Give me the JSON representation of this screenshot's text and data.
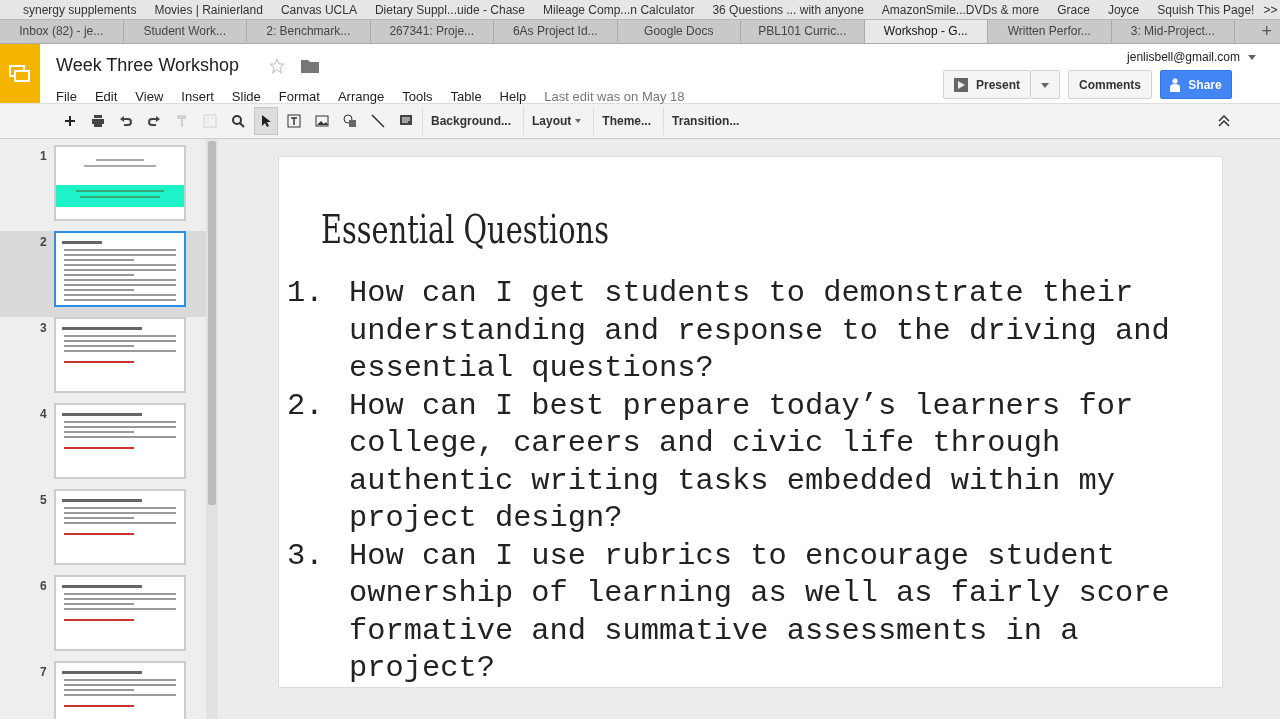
{
  "bookmarks": [
    "synergy supplements",
    "Movies | Rainierland",
    "Canvas UCLA",
    "Dietary Suppl...uide - Chase",
    "Mileage Comp...n Calculator",
    "36 Questions ... with anyone",
    "AmazonSmile...DVDs & more",
    "Grace",
    "Joyce",
    "Squish This Page!"
  ],
  "bookmarks_overflow": ">>",
  "tabs": [
    {
      "label": "Inbox (82) - je...",
      "selected": false
    },
    {
      "label": "Student Work...",
      "selected": false
    },
    {
      "label": "2: Benchmark...",
      "selected": false
    },
    {
      "label": "267341: Proje...",
      "selected": false
    },
    {
      "label": "6As Project Id...",
      "selected": false
    },
    {
      "label": "Google Docs",
      "selected": false
    },
    {
      "label": "PBL101 Curric...",
      "selected": false
    },
    {
      "label": "Workshop - G...",
      "selected": true
    },
    {
      "label": "Written Perfor...",
      "selected": false
    },
    {
      "label": "3: Mid-Project...",
      "selected": false
    }
  ],
  "new_tab": "+",
  "document": {
    "title": "Week Three Workshop",
    "starred": false
  },
  "menu": [
    "File",
    "Edit",
    "View",
    "Insert",
    "Slide",
    "Format",
    "Arrange",
    "Tools",
    "Table",
    "Help"
  ],
  "last_edit": "Last edit was on May 18",
  "account": "jenlisbell@gmail.com",
  "buttons": {
    "present": "Present",
    "comments": "Comments",
    "share": "Share"
  },
  "toolbar": [
    {
      "kind": "icon",
      "selected": false,
      "disabled": false
    },
    {
      "kind": "icon",
      "selected": false,
      "disabled": false
    },
    {
      "kind": "icon",
      "selected": false,
      "disabled": false
    },
    {
      "kind": "icon",
      "selected": false,
      "disabled": false
    },
    {
      "kind": "icon",
      "selected": false,
      "disabled": true
    },
    {
      "kind": "icon",
      "selected": false,
      "disabled": true
    },
    {
      "kind": "icon",
      "selected": false,
      "disabled": false
    },
    {
      "kind": "icon",
      "selected": true,
      "disabled": false
    },
    {
      "kind": "icon",
      "selected": false,
      "disabled": false
    },
    {
      "kind": "icon",
      "selected": false,
      "disabled": false
    },
    {
      "kind": "icon",
      "selected": false,
      "disabled": false
    },
    {
      "kind": "icon",
      "selected": false,
      "disabled": false
    },
    {
      "kind": "icon",
      "selected": false,
      "disabled": false
    },
    {
      "kind": "text",
      "label": "Background..."
    },
    {
      "kind": "dropdown",
      "label": "Layout"
    },
    {
      "kind": "text",
      "label": "Theme..."
    },
    {
      "kind": "text",
      "label": "Transition..."
    }
  ],
  "slides": [
    {
      "number": "1",
      "kind": "title",
      "selected": false
    },
    {
      "number": "2",
      "kind": "content",
      "selected": true
    },
    {
      "number": "3",
      "kind": "content",
      "selected": false
    },
    {
      "number": "4",
      "kind": "content",
      "selected": false
    },
    {
      "number": "5",
      "kind": "content",
      "selected": false
    },
    {
      "number": "6",
      "kind": "content",
      "selected": false
    },
    {
      "number": "7",
      "kind": "content",
      "selected": false
    }
  ],
  "current_slide": {
    "title": "Essential Questions",
    "questions": [
      {
        "number": "1.",
        "text": "How can I get students to demonstrate their understanding and response to the driving and essential questions?"
      },
      {
        "number": "2.",
        "text": "How can I best prepare today’s learners for college, careers and civic life through authentic writing tasks embedded within my project design?"
      },
      {
        "number": "3.",
        "text": "How can I use rubrics to encourage student ownership of learning as well as fairly score formative and summative assessments in a project?"
      }
    ]
  }
}
